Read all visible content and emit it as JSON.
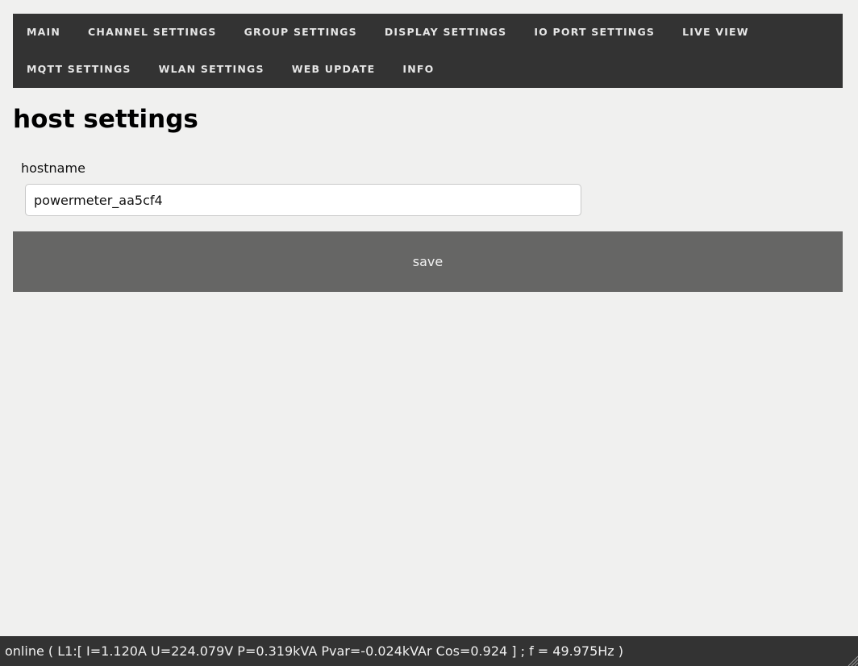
{
  "nav": {
    "items": [
      {
        "label": "MAIN"
      },
      {
        "label": "CHANNEL SETTINGS"
      },
      {
        "label": "GROUP SETTINGS"
      },
      {
        "label": "DISPLAY SETTINGS"
      },
      {
        "label": "IO PORT SETTINGS"
      },
      {
        "label": "LIVE VIEW"
      },
      {
        "label": "MQTT SETTINGS"
      },
      {
        "label": "WLAN SETTINGS"
      },
      {
        "label": "WEB UPDATE"
      },
      {
        "label": "INFO"
      }
    ]
  },
  "main": {
    "title": "host settings",
    "hostname_label": "hostname",
    "hostname_value": "powermeter_aa5cf4",
    "save_label": "save"
  },
  "status": {
    "text": "online ( L1:[ I=1.120A U=224.079V P=0.319kVA Pvar=-0.024kVAr Cos=0.924 ] ; f = 49.975Hz )"
  },
  "colors": {
    "navbar_bg": "#333333",
    "nav_text": "#e6e6e6",
    "page_bg": "#f0f0ef",
    "button_bg": "#666665",
    "statusbar_bg": "#333333"
  }
}
